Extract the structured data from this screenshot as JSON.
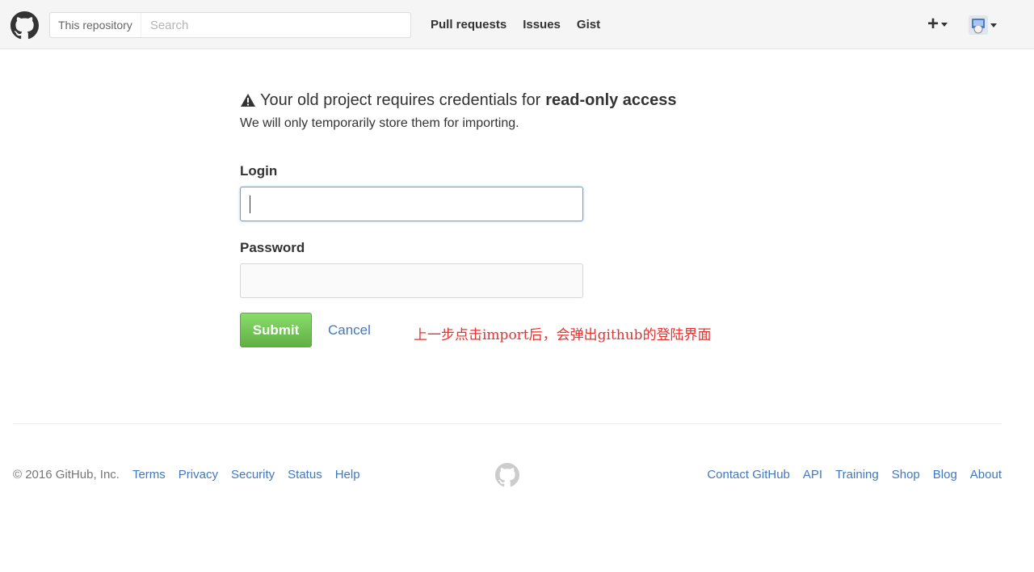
{
  "header": {
    "scope_label": "This repository",
    "search_placeholder": "Search",
    "nav": [
      "Pull requests",
      "Issues",
      "Gist"
    ],
    "create_icon": "plus-icon",
    "avatar_icon": "avatar"
  },
  "main": {
    "headline_prefix": "Your old project requires credentials for",
    "headline_strong": "read-only access",
    "subline": "We will only temporarily store them for importing.",
    "login_label": "Login",
    "login_value": "",
    "password_label": "Password",
    "password_value": "",
    "submit_label": "Submit",
    "cancel_label": "Cancel",
    "annotation": "上一步点击import后，会弹出github的登陆界面"
  },
  "footer": {
    "copyright": "© 2016 GitHub, Inc.",
    "left_links": [
      "Terms",
      "Privacy",
      "Security",
      "Status",
      "Help"
    ],
    "right_links": [
      "Contact GitHub",
      "API",
      "Training",
      "Shop",
      "Blog",
      "About"
    ]
  },
  "colors": {
    "link": "#4078c0",
    "submit_green": "#60b044",
    "annotation_red": "#e8302d",
    "focus_blue": "#51a7e8"
  }
}
